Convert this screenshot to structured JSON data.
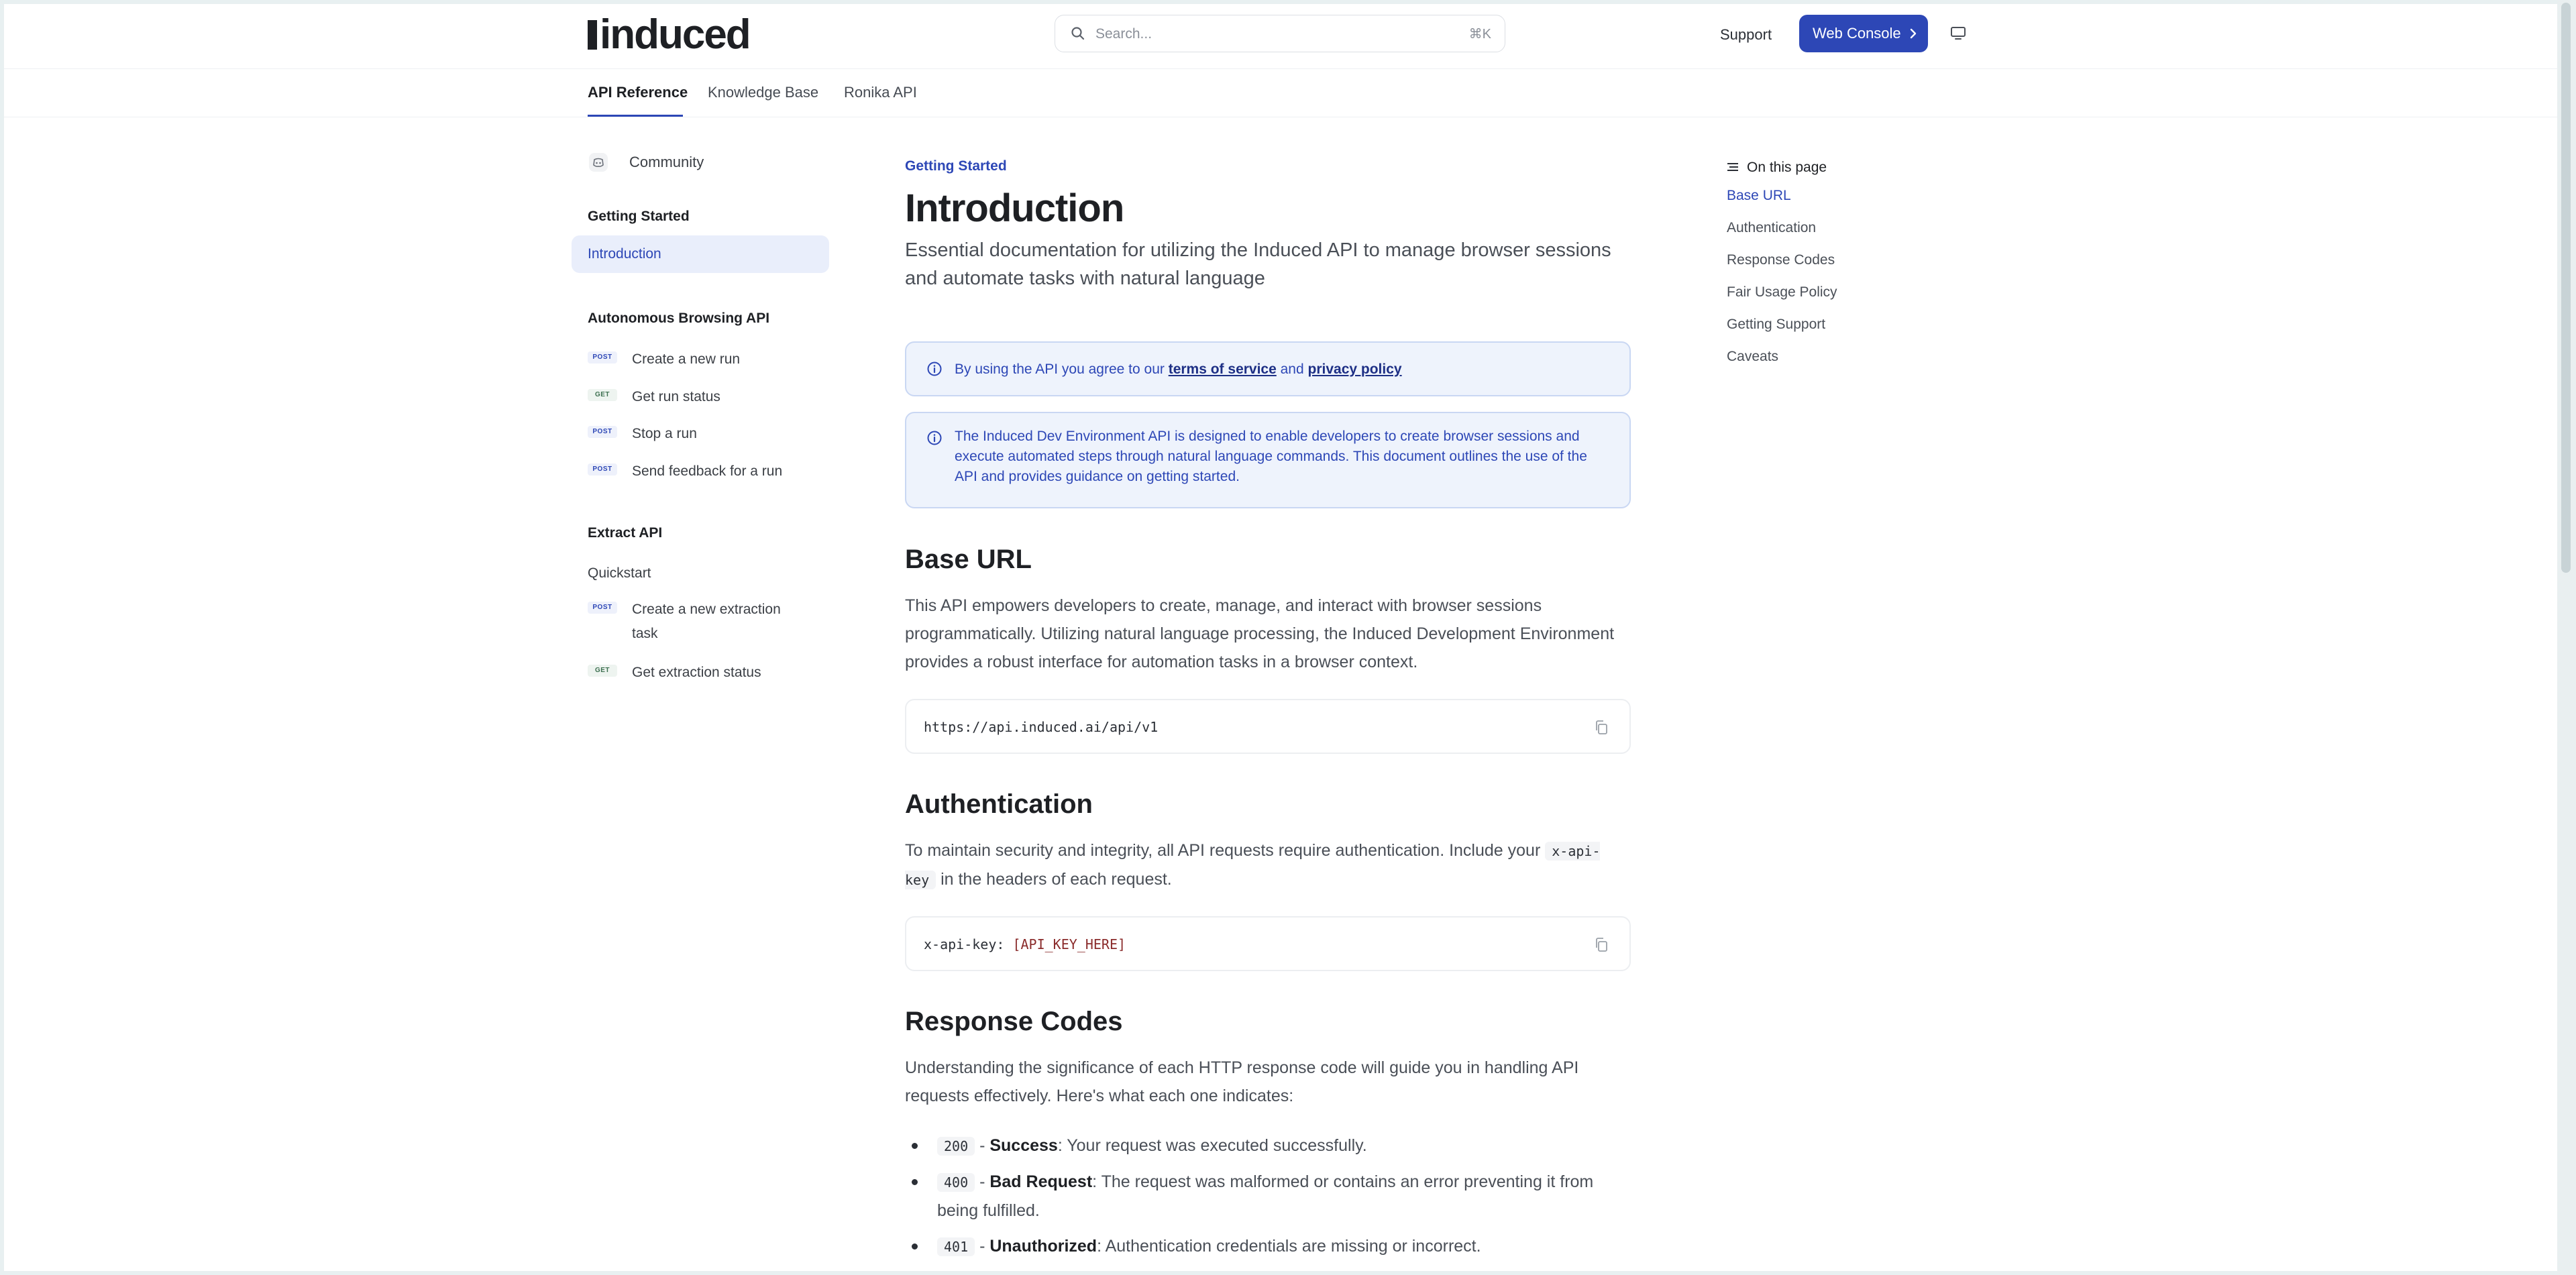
{
  "header": {
    "logo_text": "induced",
    "search_placeholder": "Search...",
    "search_shortcut": "⌘K",
    "support_label": "Support",
    "console_label": "Web Console"
  },
  "nav": {
    "tabs": [
      {
        "label": "API Reference",
        "active": true
      },
      {
        "label": "Knowledge Base"
      },
      {
        "label": "Ronika API"
      }
    ]
  },
  "sidebar": {
    "community_label": "Community",
    "getting_started": {
      "title": "Getting Started",
      "items": [
        "Introduction"
      ]
    },
    "browsing": {
      "title": "Autonomous Browsing API",
      "items": [
        {
          "method": "POST",
          "label": "Create a new run"
        },
        {
          "method": "GET",
          "label": "Get run status"
        },
        {
          "method": "POST",
          "label": "Stop a run"
        },
        {
          "method": "POST",
          "label": "Send feedback for a run"
        }
      ]
    },
    "extract": {
      "title": "Extract API",
      "quickstart": "Quickstart",
      "items": [
        {
          "method": "POST",
          "label": "Create a new extraction task"
        },
        {
          "method": "GET",
          "label": "Get extraction status"
        }
      ]
    }
  },
  "main": {
    "eyebrow": "Getting Started",
    "title": "Introduction",
    "subtitle": "Essential documentation for utilizing the Induced API to manage browser sessions and automate tasks with natural language",
    "callout1": {
      "prefix": "By using the API you agree to our ",
      "link1": "terms of service",
      "middle": " and ",
      "link2": "privacy policy"
    },
    "callout2": "The Induced Dev Environment API is designed to enable developers to create browser sessions and execute automated steps through natural language commands. This document outlines the use of the API and provides guidance on getting started.",
    "base_url": {
      "heading": "Base URL",
      "text": "This API empowers developers to create, manage, and interact with browser sessions programmatically. Utilizing natural language processing, the Induced Development Environment provides a robust interface for automation tasks in a browser context.",
      "code": "https://api.induced.ai/api/v1"
    },
    "auth": {
      "heading": "Authentication",
      "text_before": "To maintain security and integrity, all API requests require authentication. Include your ",
      "inline_code": "x-api-key",
      "text_after": " in the headers of each request.",
      "code_key": "x-api-key: ",
      "code_value": "[API_KEY_HERE]"
    },
    "response": {
      "heading": "Response Codes",
      "text": "Understanding the significance of each HTTP response code will guide you in handling API requests effectively. Here's what each one indicates:",
      "codes": [
        {
          "code": "200",
          "name": "Success",
          "desc": ": Your request was executed successfully."
        },
        {
          "code": "400",
          "name": "Bad Request",
          "desc": ": The request was malformed or contains an error preventing it from being fulfilled."
        },
        {
          "code": "401",
          "name": "Unauthorized",
          "desc": ": Authentication credentials are missing or incorrect."
        }
      ]
    }
  },
  "toc": {
    "title": "On this page",
    "links": [
      "Base URL",
      "Authentication",
      "Response Codes",
      "Fair Usage Policy",
      "Getting Support",
      "Caveats"
    ]
  },
  "colors": {
    "accent": "#2d47b6",
    "callout_bg": "#eef3fc"
  }
}
